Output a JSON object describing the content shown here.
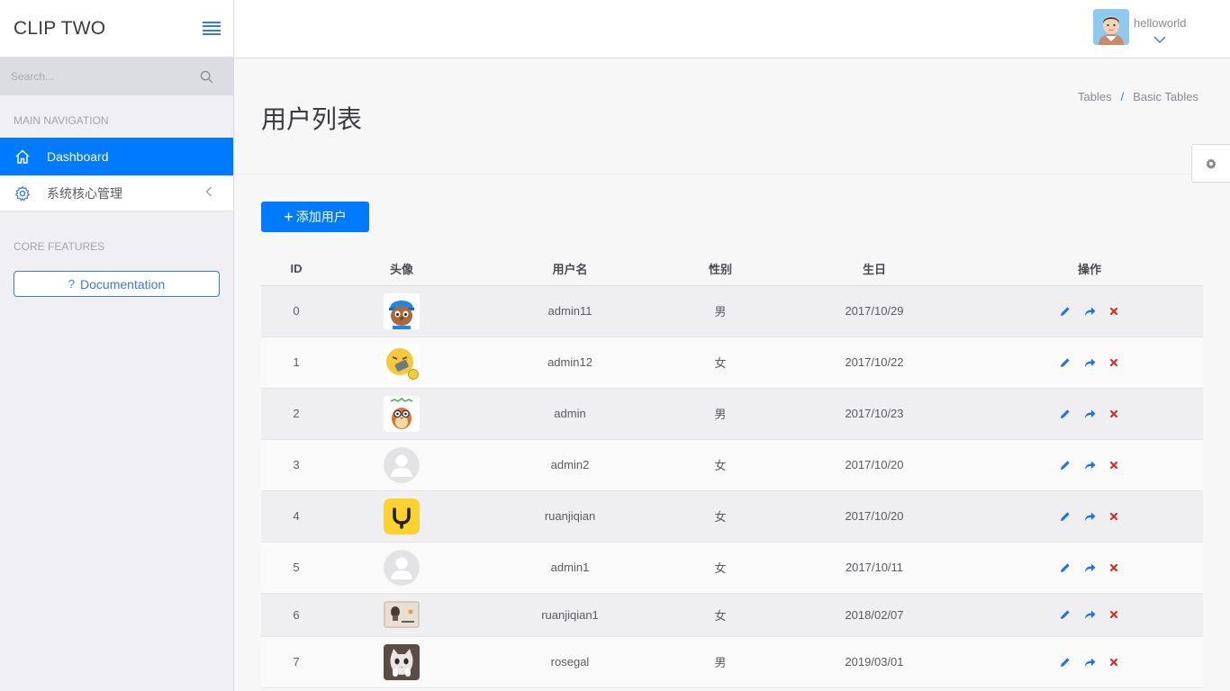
{
  "sidebar": {
    "brand": "CLIP TWO",
    "search_placeholder": "Search...",
    "section_main": "MAIN NAVIGATION",
    "nav": {
      "dashboard": "Dashboard",
      "system": "系统核心管理"
    },
    "section_core": "CORE FEATURES",
    "documentation": "Documentation"
  },
  "topbar": {
    "username": "helloworld"
  },
  "page": {
    "title": "用户列表",
    "breadcrumb": [
      "Tables",
      "/",
      "Basic Tables"
    ],
    "add_button": "添加用户"
  },
  "table": {
    "headers": [
      "ID",
      "头像",
      "用户名",
      "性别",
      "生日",
      "操作"
    ],
    "rows": [
      {
        "id": "0",
        "avatar": "pocoyo-avatar",
        "username": "admin11",
        "gender": "男",
        "birthday": "2017/10/29"
      },
      {
        "id": "1",
        "avatar": "emoji-avatar",
        "username": "admin12",
        "gender": "女",
        "birthday": "2017/10/22"
      },
      {
        "id": "2",
        "avatar": "owl-avatar",
        "username": "admin",
        "gender": "男",
        "birthday": "2017/10/23"
      },
      {
        "id": "3",
        "avatar": "default-avatar",
        "username": "admin2",
        "gender": "女",
        "birthday": "2017/10/20"
      },
      {
        "id": "4",
        "avatar": "yellow-logo-avatar",
        "username": "ruanjiqian",
        "gender": "女",
        "birthday": "2017/10/20"
      },
      {
        "id": "5",
        "avatar": "default-avatar",
        "username": "admin1",
        "gender": "女",
        "birthday": "2017/10/11"
      },
      {
        "id": "6",
        "avatar": "photo-avatar",
        "username": "ruanjiqian1",
        "gender": "女",
        "birthday": "2018/02/07"
      },
      {
        "id": "7",
        "avatar": "cat-avatar",
        "username": "rosegal",
        "gender": "男",
        "birthday": "2019/03/01"
      }
    ]
  },
  "colors": {
    "accent": "#007aff",
    "edit": "#1a73e8",
    "delete": "#d0312d"
  },
  "icons": [
    "menu-icon",
    "search-icon",
    "home-icon",
    "gear-icon",
    "chevron-left-icon",
    "question-icon",
    "chevron-down-icon",
    "settings-gear-icon",
    "plus-icon",
    "edit-icon",
    "share-icon",
    "delete-icon"
  ]
}
